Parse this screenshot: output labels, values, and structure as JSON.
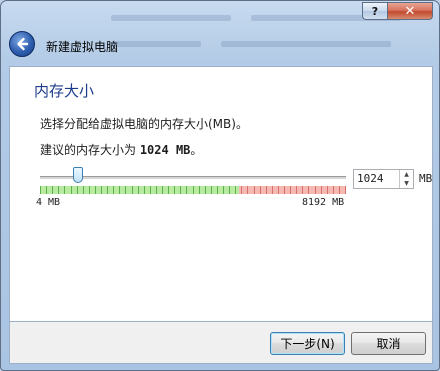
{
  "window": {
    "title": "新建虚拟电脑",
    "help_label": "?",
    "close_label": "✕"
  },
  "page": {
    "heading": "内存大小",
    "description": "选择分配给虚拟电脑的内存大小(MB)。",
    "recommend_prefix": "建议的内存大小为 ",
    "recommend_value": "1024 MB",
    "recommend_suffix": "。"
  },
  "memory": {
    "value": "1024",
    "unit": "MB",
    "min_label": "4 MB",
    "max_label": "8192 MB",
    "min_mb": 4,
    "max_mb": 8192,
    "current_mb": 1024,
    "safe_limit_fraction": 0.65
  },
  "buttons": {
    "next_label": "下一步(N)",
    "cancel_label": "取消"
  },
  "icons": {
    "back": "back-arrow-icon",
    "spin_up": "spin-up-icon",
    "spin_down": "spin-down-icon"
  }
}
